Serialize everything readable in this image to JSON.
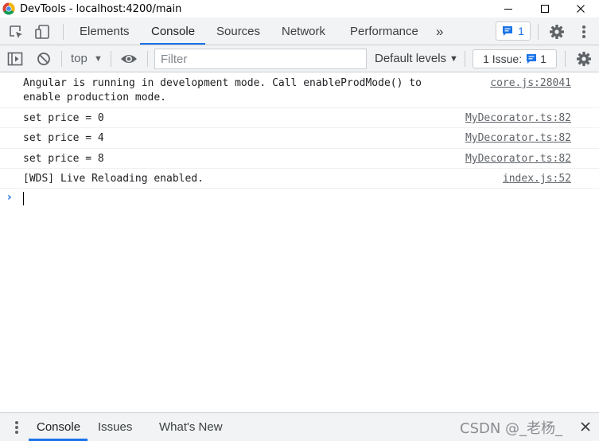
{
  "window": {
    "title": "DevTools - localhost:4200/main"
  },
  "tabs": {
    "elements": "Elements",
    "console": "Console",
    "sources": "Sources",
    "network": "Network",
    "performance": "Performance",
    "more": "»",
    "messages_count": "1"
  },
  "toolbar": {
    "context": "top",
    "filter_placeholder": "Filter",
    "levels": "Default levels",
    "issues_label": "1 Issue:",
    "issues_count": "1"
  },
  "messages": [
    {
      "text": "Angular is running in development mode. Call enableProdMode() to",
      "text2": "enable production mode.",
      "source": "core.js:28041"
    },
    {
      "text": "set price = 0",
      "source": "MyDecorator.ts:82"
    },
    {
      "text": "set price = 4",
      "source": "MyDecorator.ts:82"
    },
    {
      "text": "set price = 8",
      "source": "MyDecorator.ts:82"
    },
    {
      "text": "[WDS] Live Reloading enabled.",
      "source": "index.js:52"
    }
  ],
  "drawer": {
    "console": "Console",
    "issues": "Issues",
    "whats_new": "What's New",
    "watermark": "CSDN @_老杨_"
  },
  "colors": {
    "accent": "#1a73e8",
    "toolbar_bg": "#f1f3f4",
    "border": "#cacdd1"
  }
}
